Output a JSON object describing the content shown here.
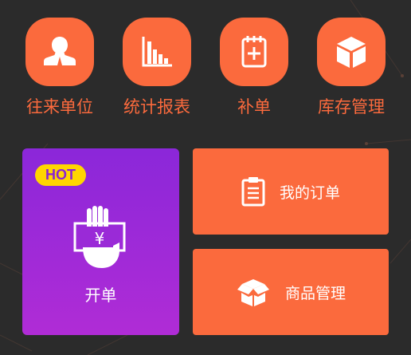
{
  "top_menu": [
    {
      "label": "往来单位",
      "icon": "user-icon"
    },
    {
      "label": "统计报表",
      "icon": "bar-chart-icon"
    },
    {
      "label": "补单",
      "icon": "notepad-plus-icon"
    },
    {
      "label": "库存管理",
      "icon": "box-icon"
    }
  ],
  "kaidan": {
    "badge": "HOT",
    "label": "开单",
    "icon": "hand-yuan-icon"
  },
  "orders": {
    "label": "我的订单",
    "icon": "clipboard-icon"
  },
  "goods": {
    "label": "商品管理",
    "icon": "open-box-icon"
  },
  "colors": {
    "background": "#2b2b2b",
    "accent": "#fb6a3d",
    "purple_top": "#8b27d9",
    "purple_bottom": "#b02cd6",
    "hot_badge": "#ffd600"
  }
}
